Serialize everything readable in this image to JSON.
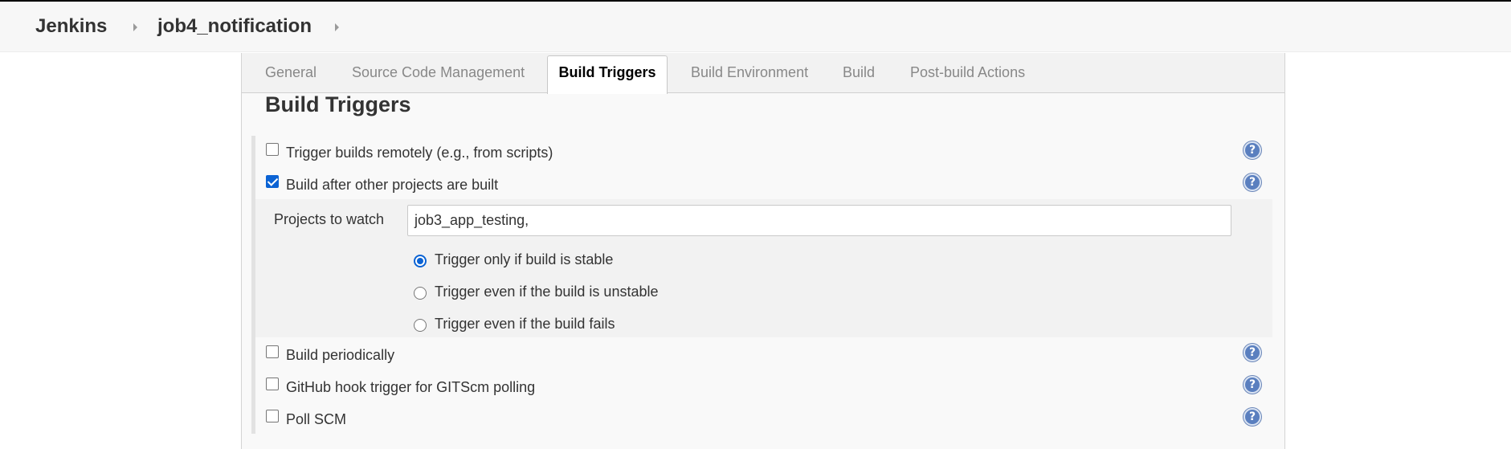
{
  "breadcrumb": {
    "root": "Jenkins",
    "job": "job4_notification"
  },
  "tabs": [
    {
      "label": "General",
      "active": false
    },
    {
      "label": "Source Code Management",
      "active": false
    },
    {
      "label": "Build Triggers",
      "active": true
    },
    {
      "label": "Build Environment",
      "active": false
    },
    {
      "label": "Build",
      "active": false
    },
    {
      "label": "Post-build Actions",
      "active": false
    }
  ],
  "section": {
    "title": "Build Triggers"
  },
  "triggers": [
    {
      "label": "Trigger builds remotely (e.g., from scripts)",
      "checked": false
    },
    {
      "label": "Build after other projects are built",
      "checked": true
    },
    {
      "label": "Build periodically",
      "checked": false
    },
    {
      "label": "GitHub hook trigger for GITScm polling",
      "checked": false
    },
    {
      "label": "Poll SCM",
      "checked": false
    }
  ],
  "build_after": {
    "projects_label": "Projects to watch",
    "projects_value": "job3_app_testing,",
    "options": [
      {
        "label": "Trigger only if build is stable",
        "selected": true
      },
      {
        "label": "Trigger even if the build is unstable",
        "selected": false
      },
      {
        "label": "Trigger even if the build fails",
        "selected": false
      }
    ]
  },
  "help": {
    "glyph": "?",
    "icon": "help-icon"
  },
  "colors": {
    "accent": "#0b63d4",
    "help_icon": "#5a7fbf",
    "breadcrumb_bg": "#f7f7f7"
  }
}
